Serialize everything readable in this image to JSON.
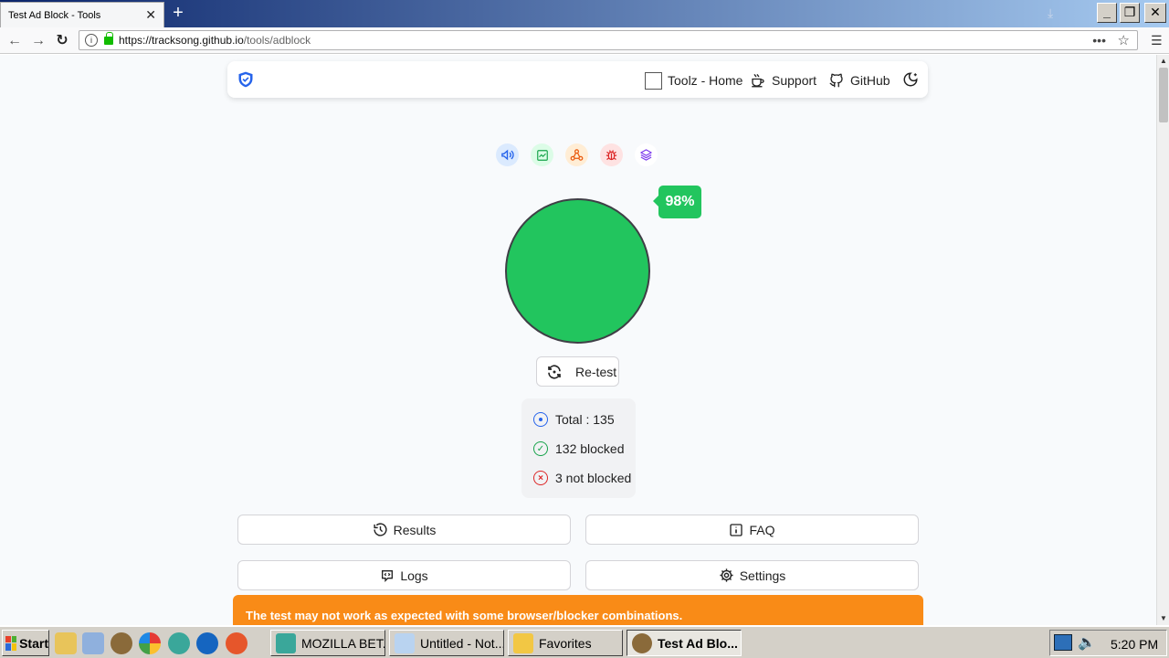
{
  "browser": {
    "tab_title": "Test Ad Block - Tools",
    "url_host": "https://tracksong.github.io",
    "url_path": "/tools/adblock"
  },
  "header": {
    "links": [
      {
        "label": "Toolz - Home",
        "icon": "checkbox-icon"
      },
      {
        "label": "Support",
        "icon": "coffee-icon"
      },
      {
        "label": "GitHub",
        "icon": "github-icon"
      }
    ],
    "theme_icon": "moon-icon"
  },
  "categories": [
    {
      "icon": "megaphone-icon",
      "color": "#2563eb",
      "bg": "#dbeafe"
    },
    {
      "icon": "chart-icon",
      "color": "#16a34a",
      "bg": "#dcfce7"
    },
    {
      "icon": "network-icon",
      "color": "#ea580c",
      "bg": "#ffedd5"
    },
    {
      "icon": "bug-icon",
      "color": "#dc2626",
      "bg": "#fee2e2"
    },
    {
      "icon": "layers-icon",
      "color": "#7c3aed",
      "bg": "#ffffff"
    }
  ],
  "result": {
    "percent_label": "98%",
    "blocked_fraction": 0.98,
    "circle_color": "#22c55e"
  },
  "retest_label": "Re-test",
  "stats": {
    "total": "Total : 135",
    "blocked": "132 blocked",
    "not_blocked": "3 not blocked"
  },
  "actions": {
    "results": "Results",
    "faq": "FAQ",
    "logs": "Logs",
    "settings": "Settings"
  },
  "warning": "The test may not work as expected with some browser/blocker combinations.",
  "taskbar": {
    "start": "Start",
    "tasks": [
      {
        "label": "MOZILLA BET..."
      },
      {
        "label": "Untitled - Not..."
      },
      {
        "label": "Favorites"
      },
      {
        "label": "Test Ad Blo..."
      }
    ],
    "clock": "5:20 PM"
  }
}
